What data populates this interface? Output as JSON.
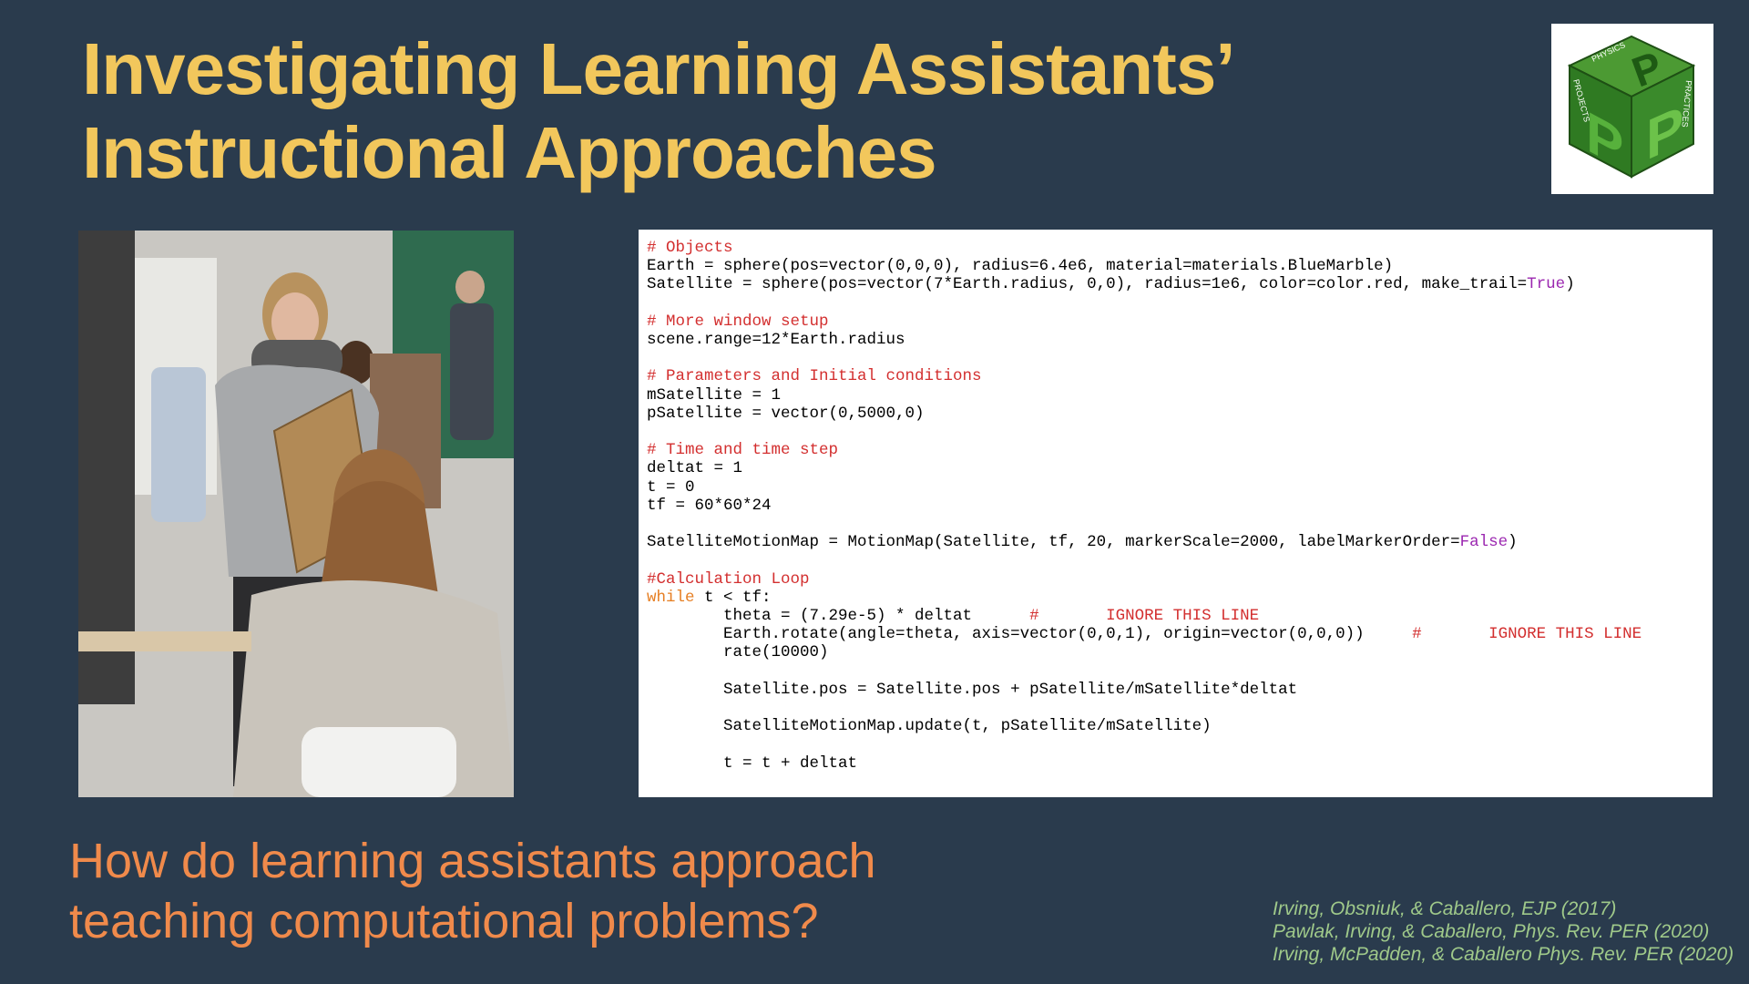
{
  "slide": {
    "title_line1": "Investigating Learning Assistants’",
    "title_line2": "Instructional Approaches",
    "question_line1": "How do learning assistants approach",
    "question_line2": "teaching computational problems?",
    "references": [
      "Irving, Obsniuk, & Caballero, EJP (2017)",
      "Pawlak, Irving, & Caballero, Phys. Rev. PER (2020)",
      "Irving, McPadden, & Caballero Phys. Rev. PER (2020)"
    ]
  },
  "logo": {
    "icon": "p3-cube-logo",
    "top_letter": "P",
    "right_letter": "P",
    "left_letter": "P",
    "top_text": "PHYSICS",
    "left_text": "PROJECTS",
    "right_text": "PRACTICES"
  },
  "photo": {
    "icon": "classroom-photo"
  },
  "code": {
    "lines": [
      {
        "text": "# Objects",
        "style": "comment"
      },
      {
        "text": "Earth = sphere(pos=vector(0,0,0), radius=6.4e6, material=materials.BlueMarble)",
        "style": "normal"
      },
      {
        "text": "Satellite = sphere(pos=vector(7*Earth.radius, 0,0), radius=1e6, color=color.red, make_trail=True)",
        "style": "true-tail"
      },
      {
        "text": "",
        "style": "normal"
      },
      {
        "text": "# More window setup",
        "style": "comment"
      },
      {
        "text": "scene.range=12*Earth.radius",
        "style": "normal"
      },
      {
        "text": "",
        "style": "normal"
      },
      {
        "text": "# Parameters and Initial conditions",
        "style": "comment"
      },
      {
        "text": "mSatellite = 1",
        "style": "normal"
      },
      {
        "text": "pSatellite = vector(0,5000,0)",
        "style": "normal"
      },
      {
        "text": "",
        "style": "normal"
      },
      {
        "text": "# Time and time step",
        "style": "comment"
      },
      {
        "text": "deltat = 1",
        "style": "normal"
      },
      {
        "text": "t = 0",
        "style": "normal"
      },
      {
        "text": "tf = 60*60*24",
        "style": "normal"
      },
      {
        "text": "",
        "style": "normal"
      },
      {
        "text": "SatelliteMotionMap = MotionMap(Satellite, tf, 20, markerScale=2000, labelMarkerOrder=False)",
        "style": "false-tail"
      },
      {
        "text": "",
        "style": "normal"
      },
      {
        "text": "#Calculation Loop",
        "style": "comment"
      },
      {
        "text": "while t < tf:",
        "style": "while"
      },
      {
        "text": "        theta = (7.29e-5) * deltat      #       IGNORE THIS LINE",
        "style": "trailing-comment"
      },
      {
        "text": "        Earth.rotate(angle=theta, axis=vector(0,0,1), origin=vector(0,0,0))     #       IGNORE THIS LINE",
        "style": "trailing-comment"
      },
      {
        "text": "        rate(10000)",
        "style": "normal"
      },
      {
        "text": "",
        "style": "normal"
      },
      {
        "text": "        Satellite.pos = Satellite.pos + pSatellite/mSatellite*deltat",
        "style": "normal"
      },
      {
        "text": "",
        "style": "normal"
      },
      {
        "text": "        SatelliteMotionMap.update(t, pSatellite/mSatellite)",
        "style": "normal"
      },
      {
        "text": "",
        "style": "normal"
      },
      {
        "text": "        t = t + deltat",
        "style": "normal"
      }
    ]
  },
  "colors": {
    "background": "#2a3b4d",
    "title": "#f2c75c",
    "question": "#f08a4b",
    "references": "#9fc98a",
    "comment": "#d32f2f",
    "keyword": "#e67e22",
    "boolean": "#9b27b0",
    "logo_green": "#3f8a2a"
  }
}
